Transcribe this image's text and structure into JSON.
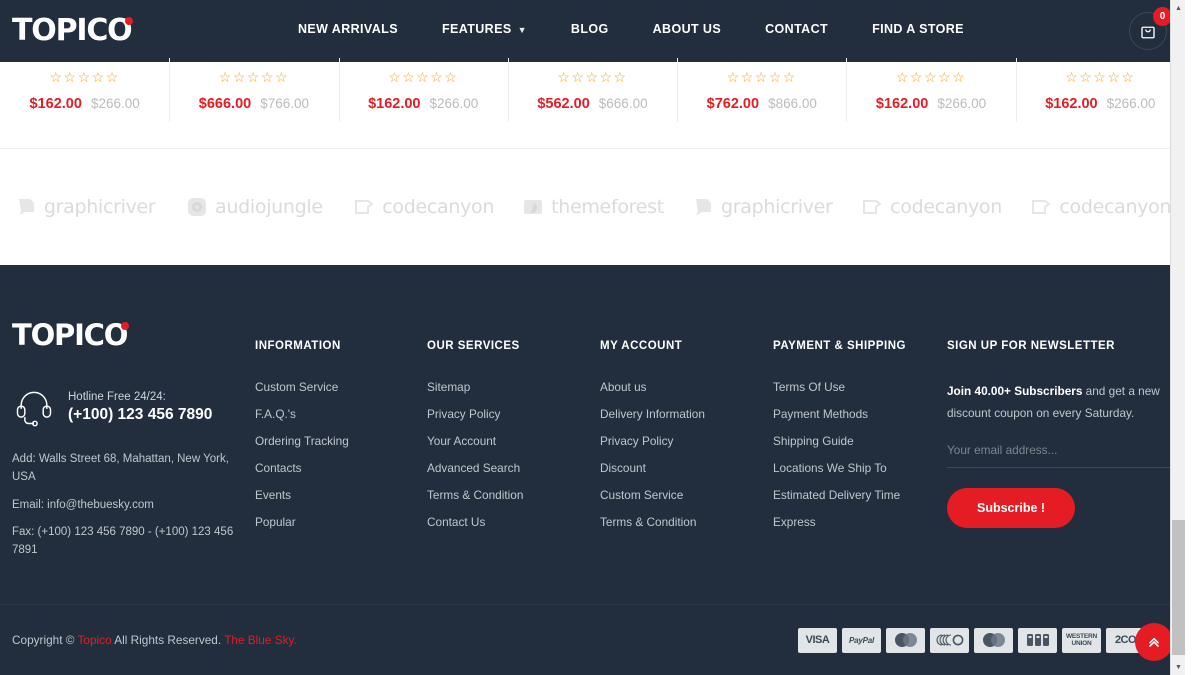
{
  "brand": {
    "name": "TOPICO",
    "accent_color": "#e51c23",
    "dark_color": "#222e3d"
  },
  "header": {
    "nav": [
      {
        "label": "NEW ARRIVALS",
        "has_caret": false
      },
      {
        "label": "FEATURES",
        "has_caret": true
      },
      {
        "label": "BLOG",
        "has_caret": false
      },
      {
        "label": "ABOUT US",
        "has_caret": false
      },
      {
        "label": "CONTACT",
        "has_caret": false
      },
      {
        "label": "FIND A STORE",
        "has_caret": false
      }
    ],
    "cart": {
      "icon": "shopping-bag-icon",
      "count": "0"
    }
  },
  "products": [
    {
      "stars": "☆☆☆☆☆",
      "rating": 0,
      "price": "$162.00",
      "old_price": "$266.00"
    },
    {
      "stars": "☆☆☆☆☆",
      "rating": 0,
      "price": "$666.00",
      "old_price": "$766.00"
    },
    {
      "stars": "☆☆☆☆☆",
      "rating": 0,
      "price": "$162.00",
      "old_price": "$266.00"
    },
    {
      "stars": "☆☆☆☆☆",
      "rating": 0,
      "price": "$562.00",
      "old_price": "$666.00"
    },
    {
      "stars": "☆☆☆☆☆",
      "rating": 0,
      "price": "$762.00",
      "old_price": "$866.00"
    },
    {
      "stars": "☆☆☆☆☆",
      "rating": 0,
      "price": "$162.00",
      "old_price": "$266.00"
    },
    {
      "stars": "☆☆☆☆☆",
      "rating": 0,
      "price": "$162.00",
      "old_price": "$266.00"
    }
  ],
  "brands": [
    {
      "name": "graphicriver",
      "icon": "graphicriver-logo"
    },
    {
      "name": "audiojungle",
      "icon": "audiojungle-logo"
    },
    {
      "name": "codecanyon",
      "icon": "codecanyon-logo"
    },
    {
      "name": "themeforest",
      "icon": "themeforest-logo"
    },
    {
      "name": "graphicriver",
      "icon": "graphicriver-logo"
    },
    {
      "name": "codecanyon",
      "icon": "codecanyon-logo"
    },
    {
      "name": "codecanyon",
      "icon": "codecanyon-logo"
    }
  ],
  "footer": {
    "logo": "TOPICO",
    "hotline": {
      "icon": "headset-icon",
      "label": "Hotline Free 24/24:",
      "number": "(+100) 123 456 7890"
    },
    "address": "Add: Walls Street 68, Mahattan, New York, USA",
    "email": "Email: info@thebuesky.com",
    "fax": "Fax: (+100) 123 456 7890 - (+100) 123 456 7891",
    "columns": [
      {
        "title": "INFORMATION",
        "links": [
          "Custom Service",
          "F.A.Q.'s",
          "Ordering Tracking",
          "Contacts",
          "Events",
          "Popular"
        ]
      },
      {
        "title": "OUR SERVICES",
        "links": [
          "Sitemap",
          "Privacy Policy",
          "Your Account",
          "Advanced Search",
          "Terms & Condition",
          "Contact Us"
        ]
      },
      {
        "title": "MY ACCOUNT",
        "links": [
          "About us",
          "Delivery Information",
          "Privacy Policy",
          "Discount",
          "Custom Service",
          "Terms & Condition"
        ]
      },
      {
        "title": "PAYMENT & SHIPPING",
        "links": [
          "Terms Of Use",
          "Payment Methods",
          "Shipping Guide",
          "Locations We Ship To",
          "Estimated Delivery Time",
          "Express"
        ]
      }
    ],
    "newsletter": {
      "title": "SIGN UP FOR NEWSLETTER",
      "bold_text": "Join 40.00+ Subscribers",
      "rest_text": " and get a new discount coupon on every Saturday.",
      "placeholder": "Your email address...",
      "button": "Subscribe !"
    }
  },
  "copyright": {
    "prefix": "Copyright © ",
    "brand": "Topico",
    "middle": " All Rights Reserved. ",
    "suffix": "The Blue Sky.",
    "payments": [
      {
        "name": "visa",
        "label": "VISA",
        "style": "big"
      },
      {
        "name": "paypal",
        "label": "PayPal",
        "style": "italic"
      },
      {
        "name": "mastercard",
        "label": "MasterCard",
        "style": "mark"
      },
      {
        "name": "discover",
        "label": "DISCOVER",
        "style": "mark"
      },
      {
        "name": "maestro",
        "label": "Maestro",
        "style": "mark"
      },
      {
        "name": "jcb",
        "label": "JCB",
        "style": "mark"
      },
      {
        "name": "western-union",
        "label": "WESTERN UNION",
        "style": "small"
      },
      {
        "name": "2co",
        "label": "2CO",
        "style": "big"
      }
    ],
    "to_top": {
      "icon": "double-chevron-up-icon"
    }
  }
}
